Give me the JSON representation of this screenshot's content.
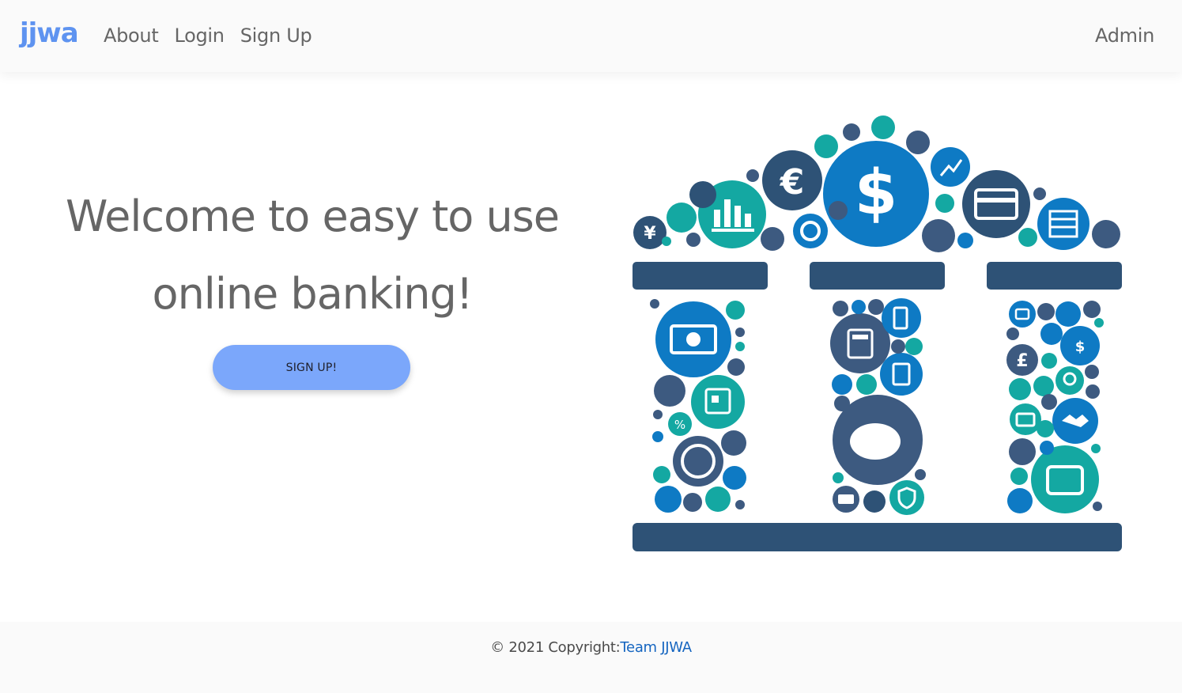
{
  "navbar": {
    "brand": "jjwa",
    "links": [
      "About",
      "Login",
      "Sign Up"
    ],
    "right_link": "Admin"
  },
  "hero": {
    "title_line1": "Welcome to easy to use",
    "title_line2": "online banking!",
    "button_label": "SIGN UP!"
  },
  "illustration": {
    "icons": [
      "dollar-icon",
      "euro-icon",
      "yen-icon",
      "pound-icon",
      "chart-icon",
      "card-icon",
      "calculator-icon",
      "piggy-bank-icon",
      "wallet-icon",
      "handshake-icon"
    ],
    "colors": {
      "navy": "#2e5276",
      "blue": "#0e7ac4",
      "teal": "#14a8a2",
      "slate": "#3d5a80"
    }
  },
  "footer": {
    "copyright": "© 2021 Copyright:",
    "link": "Team JJWA"
  }
}
